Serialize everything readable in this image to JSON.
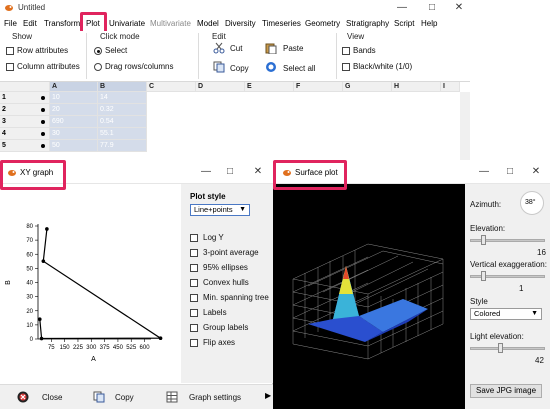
{
  "main": {
    "title": "Untitled",
    "menu": [
      "File",
      "Edit",
      "Transform",
      "Plot",
      "Univariate",
      "Multivariate",
      "Model",
      "Diversity",
      "Timeseries",
      "Geometry",
      "Stratigraphy",
      "Script",
      "Help"
    ],
    "ribbon": {
      "show_title": "Show",
      "row_attributes": "Row attributes",
      "column_attributes": "Column attributes",
      "click_mode_title": "Click mode",
      "select": "Select",
      "drag": "Drag rows/columns",
      "edit_title": "Edit",
      "cut": "Cut",
      "paste": "Paste",
      "copy": "Copy",
      "select_all": "Select all",
      "view_title": "View",
      "bands": "Bands",
      "bw": "Black/white (1/0)"
    },
    "grid": {
      "columns": [
        "A",
        "B",
        "C",
        "D",
        "E",
        "F",
        "G",
        "H",
        "I"
      ],
      "rows": [
        {
          "label": "1",
          "a": "10",
          "b": "14"
        },
        {
          "label": "2",
          "a": "20",
          "b": "0.32"
        },
        {
          "label": "3",
          "a": "690",
          "b": "0.54"
        },
        {
          "label": "4",
          "a": "30",
          "b": "55.1"
        },
        {
          "label": "5",
          "a": "50",
          "b": "77.9"
        }
      ]
    }
  },
  "xy": {
    "title": "XY graph",
    "plot_style_label": "Plot style",
    "plot_style_value": "Line+points",
    "options": [
      "Log Y",
      "3-point average",
      "95% ellipses",
      "Convex hulls",
      "Min. spanning tree",
      "Labels",
      "Group labels",
      "Flip axes"
    ],
    "close": "Close",
    "copy": "Copy",
    "graph_settings": "Graph settings"
  },
  "chart_data": {
    "type": "line",
    "title": "",
    "xlabel": "A",
    "ylabel": "B",
    "xlim": [
      0,
      625
    ],
    "ylim": [
      0,
      80
    ],
    "x_ticks": [
      "75",
      "150",
      "225",
      "300",
      "375",
      "450",
      "525",
      "600"
    ],
    "y_ticks": [
      "0",
      "10",
      "20",
      "30",
      "40",
      "50",
      "60",
      "70",
      "80"
    ],
    "series": [
      {
        "x": [
          10,
          20,
          690,
          30,
          50
        ],
        "y": [
          14,
          0.32,
          0.54,
          55.1,
          77.9
        ]
      }
    ]
  },
  "surface": {
    "title": "Surface plot",
    "azimuth_label": "Azimuth:",
    "azimuth_value": "38°",
    "elevation_label": "Elevation:",
    "elevation_value": "16",
    "vexag_label": "Vertical exaggeration:",
    "vexag_value": "1",
    "style_label": "Style",
    "style_value": "Colored",
    "light_label": "Light elevation:",
    "light_value": "42",
    "save_button": "Save JPG image"
  }
}
